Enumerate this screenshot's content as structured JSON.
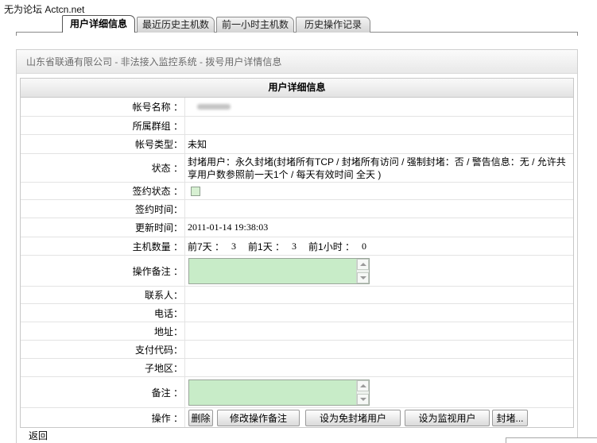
{
  "watermark": "无为论坛 Actcn.net",
  "tabs": [
    {
      "label": "用户详细信息",
      "active": true
    },
    {
      "label": "最近历史主机数"
    },
    {
      "label": "前一小时主机数"
    },
    {
      "label": "历史操作记录"
    }
  ],
  "panel": {
    "header": "山东省联通有限公司 - 非法接入监控系统 - 拨号用户详情信息"
  },
  "details": {
    "title": "用户详细信息",
    "account_name": {
      "label": "帐号名称 ：",
      "value_redacted": true
    },
    "group": {
      "label": "所属群组 ："
    },
    "account_type": {
      "label": "帐号类型：",
      "value": "未知"
    },
    "status": {
      "label": "状态 ：",
      "value": "封堵用户：永久封堵(封堵所有TCP / 封堵所有访问 / 强制封堵：否 / 警告信息：无 / 允许共享用户数参照前一天1个 / 每天有效时间 全天 )"
    },
    "contract_status": {
      "label": "签约状态 ：",
      "checked": false
    },
    "contract_time": {
      "label": "签约时间："
    },
    "update_time": {
      "label": "更新时间：",
      "value": "2011-01-14 19:38:03"
    },
    "host_count": {
      "label": "主机数量 ：",
      "items": [
        {
          "label": "前7天 ：",
          "value": "3"
        },
        {
          "label": "前1天 ：",
          "value": "3"
        },
        {
          "label": "前1小时 ：",
          "value": "0"
        }
      ]
    },
    "operation_note": {
      "label": "操作备注 ："
    },
    "contact": {
      "label": "联系人："
    },
    "phone": {
      "label": "电话："
    },
    "address": {
      "label": "地址："
    },
    "payment_code": {
      "label": "支付代码："
    },
    "sub_region": {
      "label": "子地区："
    },
    "remark": {
      "label": "备注 ："
    },
    "operations": {
      "label": "操作 ：",
      "buttons": [
        "删除",
        "修改操作备注",
        "设为免封堵用户",
        "设为监视用户",
        "封堵..."
      ]
    }
  },
  "back_link": "返回",
  "colors": {
    "textarea_bg": "#c8ecc8",
    "checkbox_bg": "#d7f0d2",
    "panel_header_text": "#6b6b6b"
  }
}
